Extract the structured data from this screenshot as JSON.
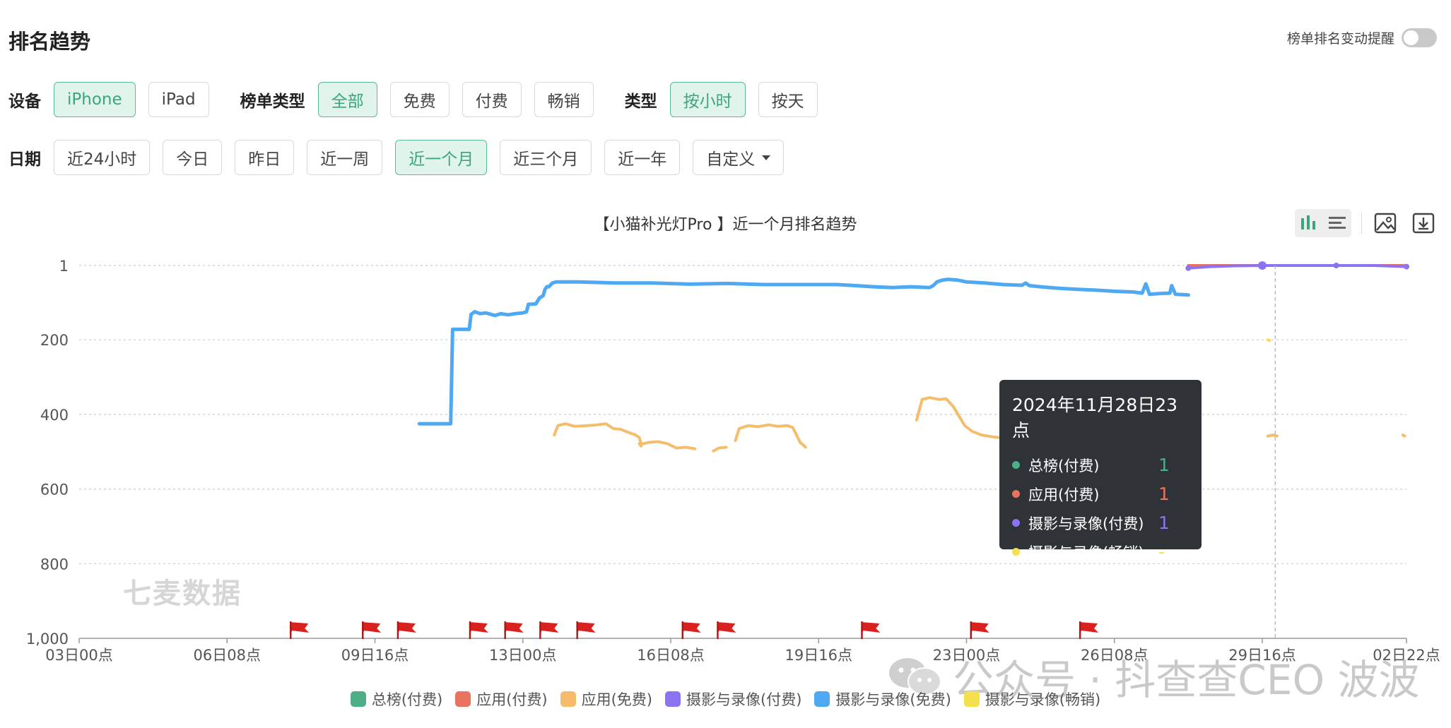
{
  "header": {
    "title": "排名趋势",
    "alert_label": "榜单排名变动提醒"
  },
  "filters": {
    "device_label": "设备",
    "devices": [
      {
        "label": "iPhone",
        "active": true
      },
      {
        "label": "iPad",
        "active": false
      }
    ],
    "list_type_label": "榜单类型",
    "list_types": [
      {
        "label": "全部",
        "active": true
      },
      {
        "label": "免费",
        "active": false
      },
      {
        "label": "付费",
        "active": false
      },
      {
        "label": "畅销",
        "active": false
      }
    ],
    "type_label": "类型",
    "types": [
      {
        "label": "按小时",
        "active": true
      },
      {
        "label": "按天",
        "active": false
      }
    ],
    "date_label": "日期",
    "dates": [
      {
        "label": "近24小时",
        "active": false
      },
      {
        "label": "今日",
        "active": false
      },
      {
        "label": "昨日",
        "active": false
      },
      {
        "label": "近一周",
        "active": false
      },
      {
        "label": "近一个月",
        "active": true
      },
      {
        "label": "近三个月",
        "active": false
      },
      {
        "label": "近一年",
        "active": false
      },
      {
        "label": "自定义",
        "active": false
      }
    ]
  },
  "tooltip": {
    "header": "2024年11月28日23点",
    "rows": [
      {
        "name": "总榜(付费)",
        "value": "1",
        "color": "#4caf87"
      },
      {
        "name": "应用(付费)",
        "value": "1",
        "color": "#e8735e"
      },
      {
        "name": "摄影与录像(付费)",
        "value": "1",
        "color": "#8b73f2"
      },
      {
        "name": "摄影与录像(畅销)",
        "value": "-",
        "color": "#f5df4d"
      }
    ]
  },
  "watermarks": {
    "brand": "七麦数据",
    "wechat": "公众号 · 抖查查CEO 波波"
  },
  "chart_data": {
    "type": "line",
    "title": "【小猫补光灯Pro 】近一个月排名趋势",
    "xlabel": "",
    "ylabel": "",
    "y_inverted": true,
    "ylim": [
      1,
      1000
    ],
    "y_ticks": [
      "1",
      "200",
      "400",
      "600",
      "800",
      "1,000"
    ],
    "y_tick_values": [
      1,
      200,
      400,
      600,
      800,
      1000
    ],
    "x_ticks": [
      "03日00点",
      "06日08点",
      "09日16点",
      "13日00点",
      "16日08点",
      "19日16点",
      "23日00点",
      "26日08点",
      "29日16点",
      "02日22点"
    ],
    "x_tick_hours": [
      0,
      80,
      160,
      240,
      320,
      400,
      480,
      560,
      640,
      718
    ],
    "x_range_hours": [
      0,
      718
    ],
    "hover_hour": 647,
    "event_flag_hours": [
      119,
      158,
      177,
      216,
      235,
      254,
      274,
      331,
      350,
      428,
      487,
      546
    ],
    "grid": true,
    "legend_position": "bottom",
    "series": [
      {
        "name": "总榜(付费)",
        "color": "#4caf87",
        "points": [
          [
            600,
            1
          ],
          [
            718,
            1
          ]
        ]
      },
      {
        "name": "应用(付费)",
        "color": "#e8735e",
        "points": [
          [
            600,
            1
          ],
          [
            718,
            1
          ]
        ]
      },
      {
        "name": "应用(免费)",
        "color": "#f5bd6b",
        "segments": [
          [
            [
              257,
              455
            ],
            [
              259,
              430
            ],
            [
              263,
              425
            ],
            [
              268,
              432
            ],
            [
              275,
              430
            ],
            [
              280,
              428
            ],
            [
              285,
              425
            ],
            [
              289,
              438
            ],
            [
              293,
              440
            ],
            [
              297,
              448
            ],
            [
              301,
              455
            ],
            [
              303,
              462
            ],
            [
              304,
              478
            ]
          ],
          [
            [
              303,
              478
            ],
            [
              304,
              485
            ]
          ],
          [
            [
              304,
              480
            ],
            [
              308,
              475
            ],
            [
              313,
              473
            ],
            [
              318,
              478
            ],
            [
              323,
              490
            ],
            [
              328,
              488
            ],
            [
              333,
              492
            ]
          ],
          [
            [
              343,
              498
            ],
            [
              346,
              490
            ],
            [
              350,
              488
            ]
          ],
          [
            [
              355,
              470
            ],
            [
              357,
              438
            ],
            [
              362,
              430
            ],
            [
              367,
              433
            ],
            [
              373,
              428
            ],
            [
              378,
              432
            ],
            [
              383,
              430
            ],
            [
              386,
              435
            ],
            [
              388,
              455
            ],
            [
              390,
              475
            ],
            [
              393,
              488
            ]
          ],
          [
            [
              453,
              415
            ],
            [
              456,
              360
            ],
            [
              460,
              355
            ],
            [
              465,
              360
            ],
            [
              469,
              358
            ],
            [
              473,
              380
            ],
            [
              476,
              405
            ],
            [
              479,
              430
            ],
            [
              483,
              445
            ],
            [
              488,
              455
            ],
            [
              494,
              460
            ],
            [
              498,
              462
            ],
            [
              500,
              468
            ],
            [
              502,
              495
            ]
          ],
          [
            [
              643,
              458
            ],
            [
              646,
              455
            ],
            [
              648,
              458
            ]
          ],
          [
            [
              716,
              455
            ],
            [
              717,
              458
            ]
          ]
        ]
      },
      {
        "name": "摄影与录像(付费)",
        "color": "#8b73f2",
        "points": [
          [
            600,
            8
          ],
          [
            612,
            4
          ],
          [
            625,
            2
          ],
          [
            640,
            1
          ],
          [
            660,
            1
          ],
          [
            680,
            1
          ],
          [
            700,
            1
          ],
          [
            718,
            4
          ]
        ]
      },
      {
        "name": "摄影与录像(免费)",
        "color": "#4fa8f2",
        "points": [
          [
            184,
            425
          ],
          [
            201,
            425
          ],
          [
            202,
            172
          ],
          [
            211,
            172
          ],
          [
            212,
            132
          ],
          [
            214,
            125
          ],
          [
            217,
            130
          ],
          [
            220,
            128
          ],
          [
            225,
            135
          ],
          [
            228,
            130
          ],
          [
            232,
            133
          ],
          [
            236,
            130
          ],
          [
            240,
            128
          ],
          [
            242,
            125
          ],
          [
            243,
            105
          ],
          [
            247,
            104
          ],
          [
            249,
            88
          ],
          [
            251,
            82
          ],
          [
            252,
            65
          ],
          [
            253,
            58
          ],
          [
            254,
            58
          ],
          [
            256,
            48
          ],
          [
            258,
            45
          ],
          [
            270,
            45
          ],
          [
            290,
            48
          ],
          [
            310,
            48
          ],
          [
            330,
            51
          ],
          [
            350,
            49
          ],
          [
            370,
            52
          ],
          [
            390,
            52
          ],
          [
            410,
            52
          ],
          [
            420,
            55
          ],
          [
            430,
            58
          ],
          [
            440,
            60
          ],
          [
            450,
            58
          ],
          [
            460,
            60
          ],
          [
            462,
            55
          ],
          [
            464,
            45
          ],
          [
            467,
            40
          ],
          [
            470,
            38
          ],
          [
            475,
            40
          ],
          [
            480,
            45
          ],
          [
            490,
            48
          ],
          [
            500,
            52
          ],
          [
            510,
            54
          ],
          [
            512,
            48
          ],
          [
            514,
            55
          ],
          [
            520,
            58
          ],
          [
            525,
            60
          ],
          [
            530,
            62
          ],
          [
            540,
            65
          ],
          [
            550,
            67
          ],
          [
            560,
            70
          ],
          [
            570,
            72
          ],
          [
            575,
            75
          ],
          [
            577,
            50
          ],
          [
            579,
            78
          ],
          [
            585,
            76
          ],
          [
            590,
            75
          ],
          [
            591,
            55
          ],
          [
            593,
            78
          ],
          [
            597,
            79
          ],
          [
            600,
            80
          ]
        ]
      },
      {
        "name": "摄影与录像(畅销)",
        "color": "#f5df4d",
        "points": [
          [
            643,
            200
          ],
          [
            644,
            202
          ]
        ]
      }
    ]
  }
}
